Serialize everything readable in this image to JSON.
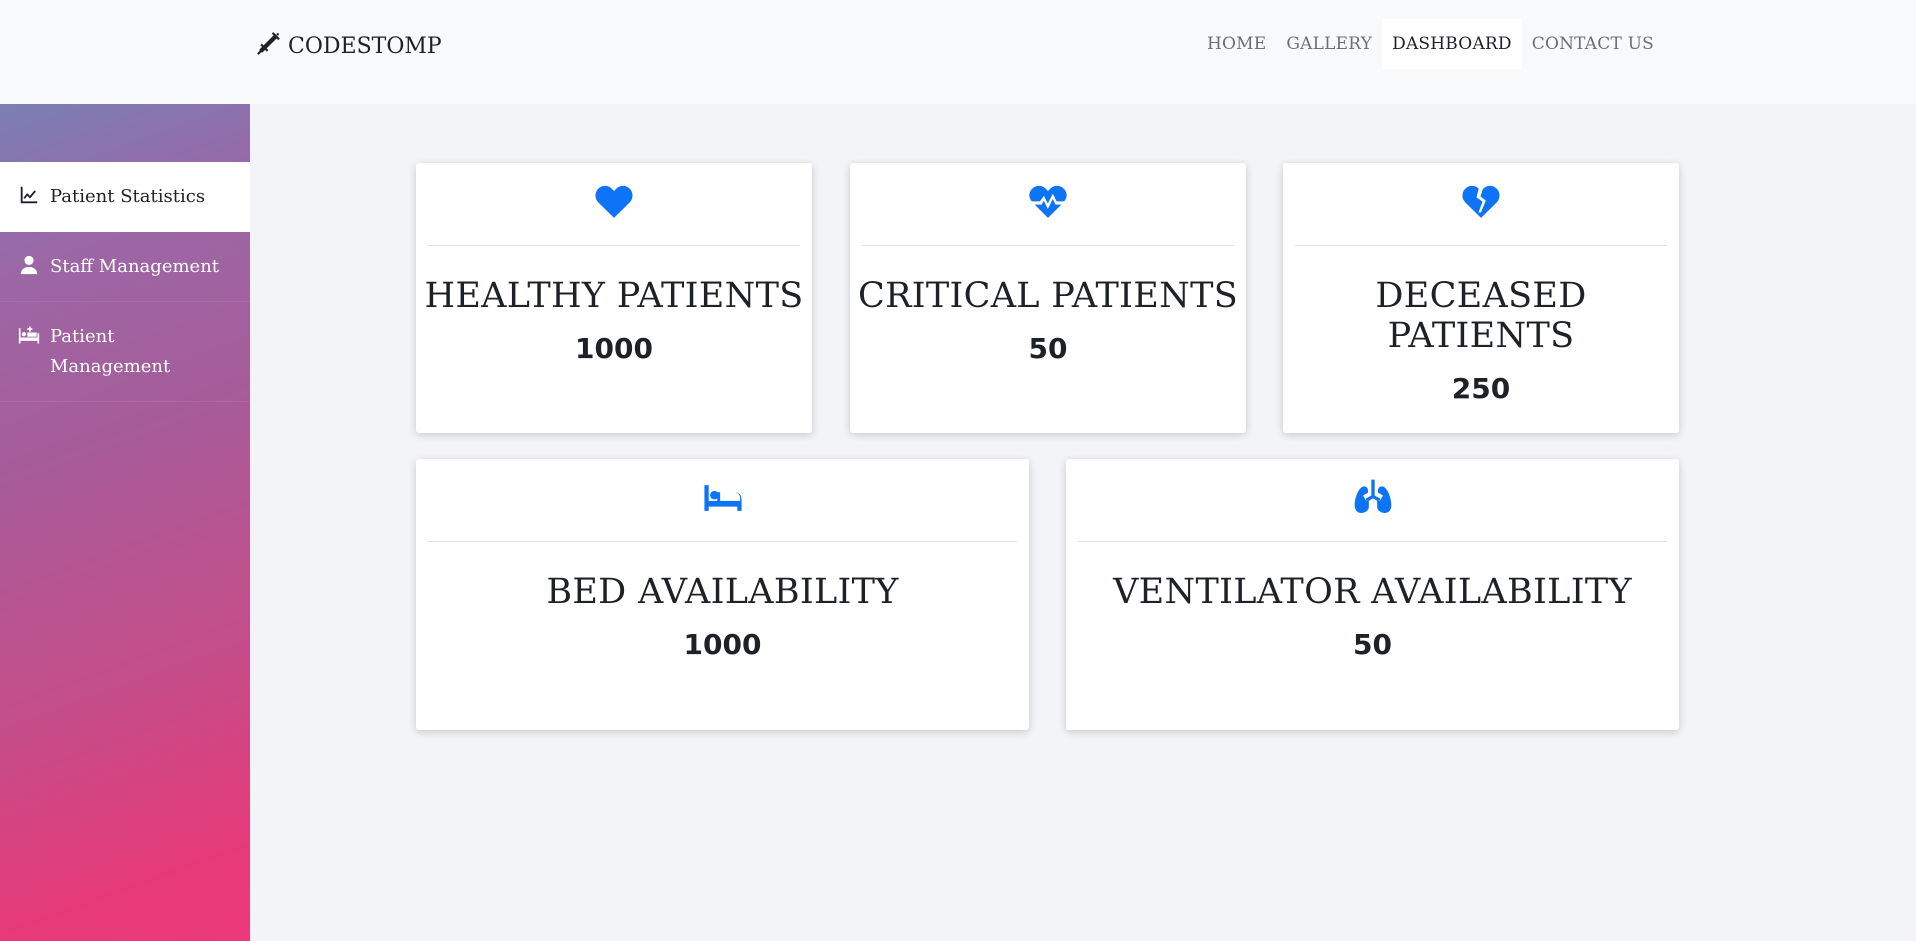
{
  "brand": {
    "name": "CODESTOMP",
    "icon": "syringe-icon"
  },
  "nav": {
    "items": [
      {
        "label": "HOME"
      },
      {
        "label": "GALLERY"
      },
      {
        "label": "DASHBOARD",
        "active": true
      },
      {
        "label": "CONTACT US"
      }
    ]
  },
  "sidebar": {
    "items": [
      {
        "label": "Patient Statistics",
        "icon": "chart-line-icon",
        "active": true
      },
      {
        "label": "Staff Management",
        "icon": "user-icon"
      },
      {
        "label": "Patient Management",
        "icon": "hospital-bed-icon"
      }
    ]
  },
  "cards": [
    {
      "title": "HEALTHY PATIENTS",
      "value": "1000",
      "icon": "heart-icon"
    },
    {
      "title": "CRITICAL PATIENTS",
      "value": "50",
      "icon": "heartbeat-icon"
    },
    {
      "title": "DECEASED PATIENTS",
      "value": "250",
      "icon": "heart-broken-icon"
    },
    {
      "title": "BED AVAILABILITY",
      "value": "1000",
      "icon": "bed-icon"
    },
    {
      "title": "VENTILATOR AVAILABILITY",
      "value": "50",
      "icon": "lungs-icon"
    }
  ],
  "colors": {
    "accent": "#0d74f5",
    "sidebar_top": "#7a7fb5",
    "sidebar_bottom": "#ec3977"
  }
}
